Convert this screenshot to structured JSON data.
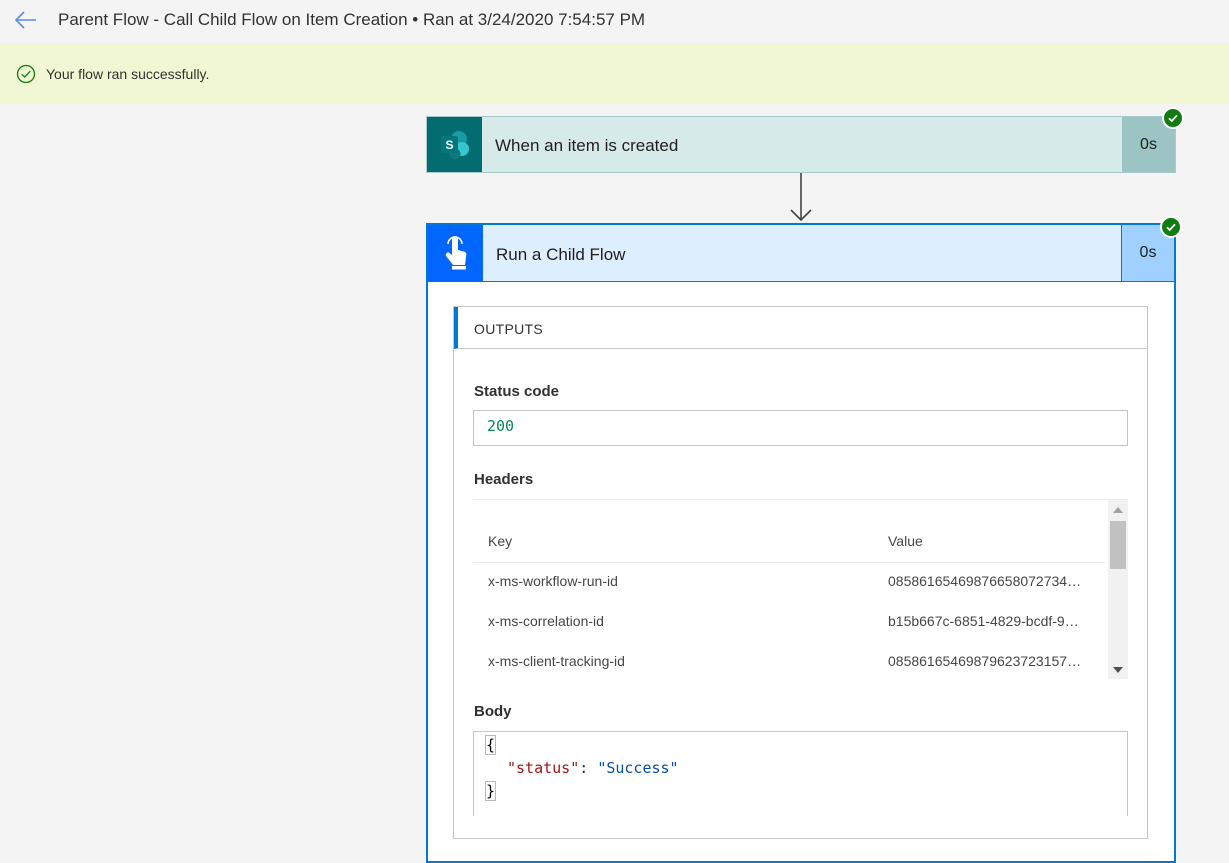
{
  "header": {
    "title": "Parent Flow - Call Child Flow on Item Creation • Ran at 3/24/2020 7:54:57 PM",
    "back_icon": "arrow-left-icon"
  },
  "banner": {
    "message": "Your flow ran successfully.",
    "icon": "success-circle-check-icon",
    "color": "#f1f7d2"
  },
  "steps": [
    {
      "title": "When an item is created",
      "duration": "0s",
      "icon": "sharepoint-icon",
      "icon_letter": "S",
      "status": "succeeded",
      "color": "#036c70"
    },
    {
      "title": "Run a Child Flow",
      "duration": "0s",
      "icon": "touch-hand-icon",
      "status": "succeeded",
      "color": "#0066ff"
    }
  ],
  "outputs": {
    "title": "OUTPUTS",
    "status_code_label": "Status code",
    "status_code": "200",
    "headers_label": "Headers",
    "headers_columns": [
      "Key",
      "Value"
    ],
    "headers_rows": [
      {
        "key": "x-ms-workflow-run-id",
        "value": "08586165469876658072734…"
      },
      {
        "key": "x-ms-correlation-id",
        "value": "b15b667c-6851-4829-bcdf-9…"
      },
      {
        "key": "x-ms-client-tracking-id",
        "value": "08586165469879623723157…"
      }
    ],
    "body_label": "Body",
    "body_lines": {
      "open": "{",
      "key": "\"status\"",
      "colon": ": ",
      "value": "\"Success\"",
      "close": "}"
    }
  }
}
